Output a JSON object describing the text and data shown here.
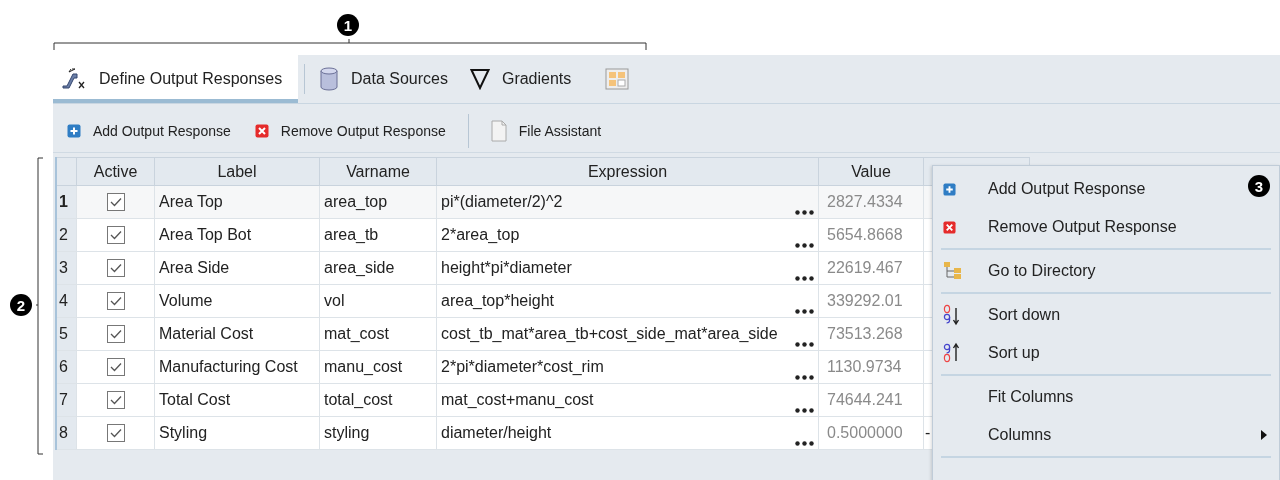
{
  "callouts": [
    "1",
    "2",
    "3"
  ],
  "tabs": [
    {
      "label": "Define Output Responses",
      "selected": true
    },
    {
      "label": "Data Sources",
      "selected": false
    },
    {
      "label": "Gradients",
      "selected": false
    },
    {
      "selected": false
    }
  ],
  "toolbar": [
    "Add Output Response",
    "Remove Output Response",
    "File Assistant"
  ],
  "table": {
    "columns": [
      "Active",
      "Label",
      "Varname",
      "Expression",
      "Value"
    ],
    "rows": [
      {
        "number": "1",
        "selected": true,
        "active": true,
        "label": "Area Top",
        "varname": "area_top",
        "expression": "pi*(diameter/2)^2",
        "value": "2827.4334"
      },
      {
        "number": "2",
        "selected": false,
        "active": true,
        "label": "Area Top Bot",
        "varname": "area_tb",
        "expression": "2*area_top",
        "value": "5654.8668"
      },
      {
        "number": "3",
        "selected": false,
        "active": true,
        "label": "Area Side",
        "varname": "area_side",
        "expression": "height*pi*diameter",
        "value": "22619.467"
      },
      {
        "number": "4",
        "selected": false,
        "active": true,
        "label": "Volume",
        "varname": "vol",
        "expression": "area_top*height",
        "value": "339292.01"
      },
      {
        "number": "5",
        "selected": false,
        "active": true,
        "label": "Material Cost",
        "varname": "mat_cost",
        "expression": "cost_tb_mat*area_tb+cost_side_mat*area_side",
        "value": "73513.268"
      },
      {
        "number": "6",
        "selected": false,
        "active": true,
        "label": "Manufacturing Cost",
        "varname": "manu_cost",
        "expression": "2*pi*diameter*cost_rim",
        "value": "1130.9734"
      },
      {
        "number": "7",
        "selected": false,
        "active": true,
        "label": "Total Cost",
        "varname": "total_cost",
        "expression": "mat_cost+manu_cost",
        "value": "74644.241"
      },
      {
        "number": "8",
        "selected": false,
        "active": true,
        "label": "Styling",
        "varname": "styling",
        "expression": "diameter/height",
        "value": "0.5000000",
        "column_6": "-"
      }
    ]
  },
  "context_menu": {
    "groups": [
      [
        {
          "label": "Add Output Response"
        },
        {
          "label": "Remove Output Response"
        }
      ],
      [
        {
          "label": "Go to Directory"
        }
      ],
      [
        {
          "label": "Sort down"
        },
        {
          "label": "Sort up"
        }
      ],
      [
        {
          "label": "Fit Columns"
        },
        {
          "label": "Columns",
          "submenu": true
        }
      ]
    ]
  }
}
